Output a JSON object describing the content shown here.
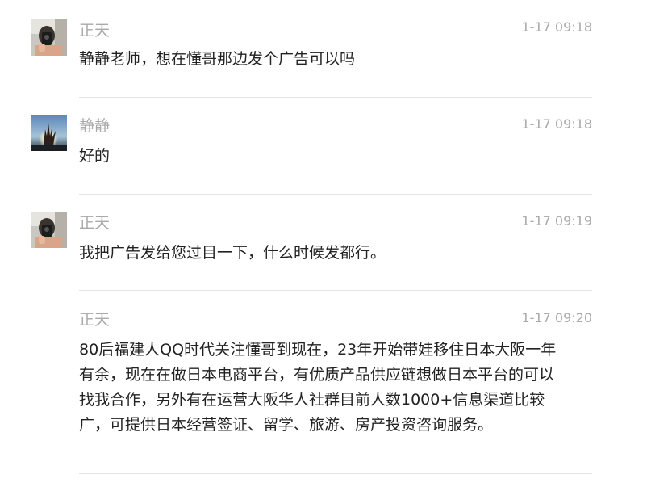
{
  "messages": [
    {
      "sender": "正天",
      "time": "1-17 09:18",
      "text": "静静老师，想在懂哥那边发个广告可以吗",
      "avatar": "avatar-zhengtian"
    },
    {
      "sender": "静静",
      "time": "1-17 09:18",
      "text": "好的",
      "avatar": "avatar-jingjing"
    },
    {
      "sender": "正天",
      "time": "1-17 09:19",
      "text": "我把广告发给您过目一下，什么时候发都行。",
      "avatar": "avatar-zhengtian"
    },
    {
      "sender": "正天",
      "time": "1-17 09:20",
      "text": "80后福建人QQ时代关注懂哥到现在，23年开始带娃移住日本大阪一年有余，现在在做日本电商平台，有优质产品供应链想做日本平台的可以找我合作，另外有在运营大阪华人社群目前人数1000+信息渠道比较广，可提供日本经营签证、留学、旅游、房产投资咨询服务。"
    }
  ]
}
